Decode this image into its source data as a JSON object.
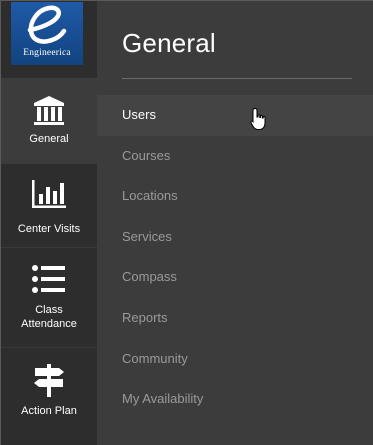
{
  "logo": {
    "text": "Engineerica",
    "brand_color": "#1a4f98"
  },
  "rail": {
    "items": [
      {
        "label": "General",
        "icon": "building-icon",
        "active": true
      },
      {
        "label": "Center Visits",
        "icon": "bar-chart-icon",
        "active": false
      },
      {
        "label": "Class Attendance",
        "icon": "list-icon",
        "active": false
      },
      {
        "label": "Action Plan",
        "icon": "signpost-icon",
        "active": false
      }
    ]
  },
  "panel": {
    "title": "General",
    "items": [
      {
        "label": "Users",
        "hover": true
      },
      {
        "label": "Courses",
        "hover": false
      },
      {
        "label": "Locations",
        "hover": false
      },
      {
        "label": "Services",
        "hover": false
      },
      {
        "label": "Compass",
        "hover": false
      },
      {
        "label": "Reports",
        "hover": false
      },
      {
        "label": "Community",
        "hover": false
      },
      {
        "label": "My Availability",
        "hover": false
      }
    ]
  },
  "colors": {
    "rail_bg": "#2d2d2d",
    "panel_bg": "#3c3c3c",
    "menu_text": "#9a9a9a",
    "menu_text_hover": "#ffffff"
  }
}
